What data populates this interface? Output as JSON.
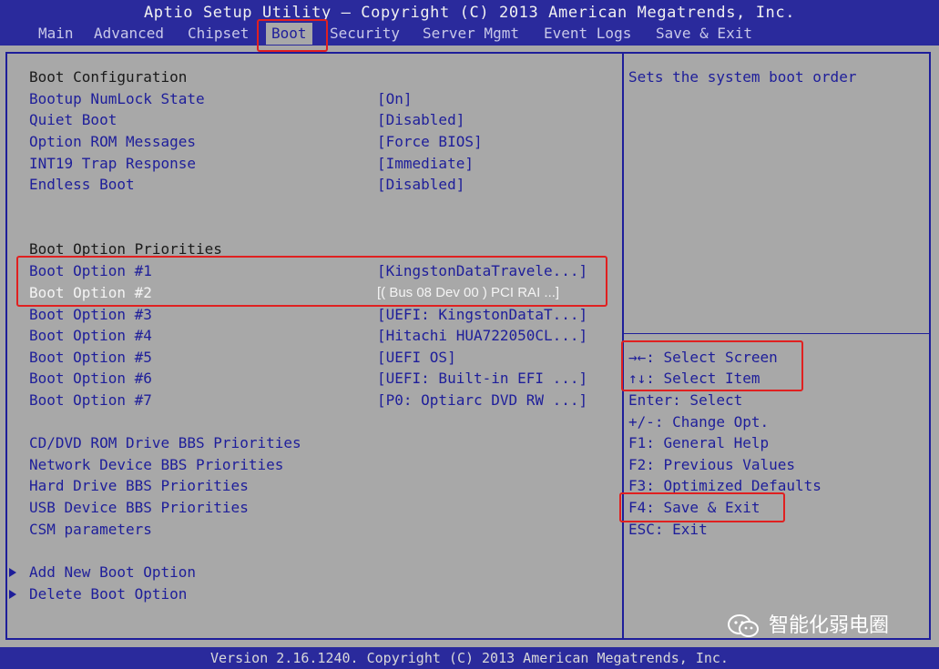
{
  "header": {
    "title": "Aptio Setup Utility – Copyright (C) 2013 American Megatrends, Inc.",
    "tabs": [
      {
        "label": "Main",
        "active": false
      },
      {
        "label": "Advanced",
        "active": false
      },
      {
        "label": "Chipset",
        "active": false
      },
      {
        "label": "Boot",
        "active": true
      },
      {
        "label": "Security",
        "active": false
      },
      {
        "label": "Server Mgmt",
        "active": false
      },
      {
        "label": "Event Logs",
        "active": false
      },
      {
        "label": "Save & Exit",
        "active": false
      }
    ]
  },
  "boot_config": {
    "heading": "Boot Configuration",
    "items": [
      {
        "label": "Bootup NumLock State",
        "value": "[On]"
      },
      {
        "label": "Quiet Boot",
        "value": "[Disabled]"
      },
      {
        "label": "Option ROM Messages",
        "value": "[Force BIOS]"
      },
      {
        "label": "INT19 Trap Response",
        "value": "[Immediate]"
      },
      {
        "label": "Endless Boot",
        "value": "[Disabled]"
      }
    ]
  },
  "boot_priorities": {
    "heading": "Boot Option Priorities",
    "items": [
      {
        "label": "Boot Option #1",
        "value": "[KingstonDataTravele...]"
      },
      {
        "label": "Boot Option #2",
        "value": "[( Bus 08 Dev 00 ) PCI RAI ...]",
        "selected": true
      },
      {
        "label": "Boot Option #3",
        "value": "[UEFI: KingstonDataT...]"
      },
      {
        "label": "Boot Option #4",
        "value": "[Hitachi HUA722050CL...]"
      },
      {
        "label": "Boot Option #5",
        "value": "[UEFI OS]"
      },
      {
        "label": "Boot Option #6",
        "value": "[UEFI: Built-in EFI ...]"
      },
      {
        "label": "Boot Option #7",
        "value": "[P0: Optiarc DVD RW ...]"
      }
    ]
  },
  "bbs_links": [
    "CD/DVD ROM Drive BBS Priorities",
    "Network Device BBS Priorities",
    "Hard Drive BBS Priorities",
    "USB Device BBS Priorities",
    "CSM parameters"
  ],
  "submenus": [
    "Add New Boot Option",
    "Delete Boot Option"
  ],
  "help_text": "Sets the system boot order",
  "key_help": [
    "→←: Select Screen",
    "↑↓: Select Item",
    "Enter: Select",
    "+/-: Change Opt.",
    "F1: General Help",
    "F2: Previous Values",
    "F3: Optimized Defaults",
    "F4: Save & Exit",
    "ESC: Exit"
  ],
  "footer": "Version 2.16.1240. Copyright (C) 2013 American Megatrends, Inc.",
  "watermark": "智能化弱电圈",
  "colors": {
    "title_bar": "#2a2a9c",
    "background": "#a8a8a8",
    "text_blue": "#1e1e9a",
    "highlight_red": "#e02020",
    "selected_text": "#f4f4f4"
  }
}
